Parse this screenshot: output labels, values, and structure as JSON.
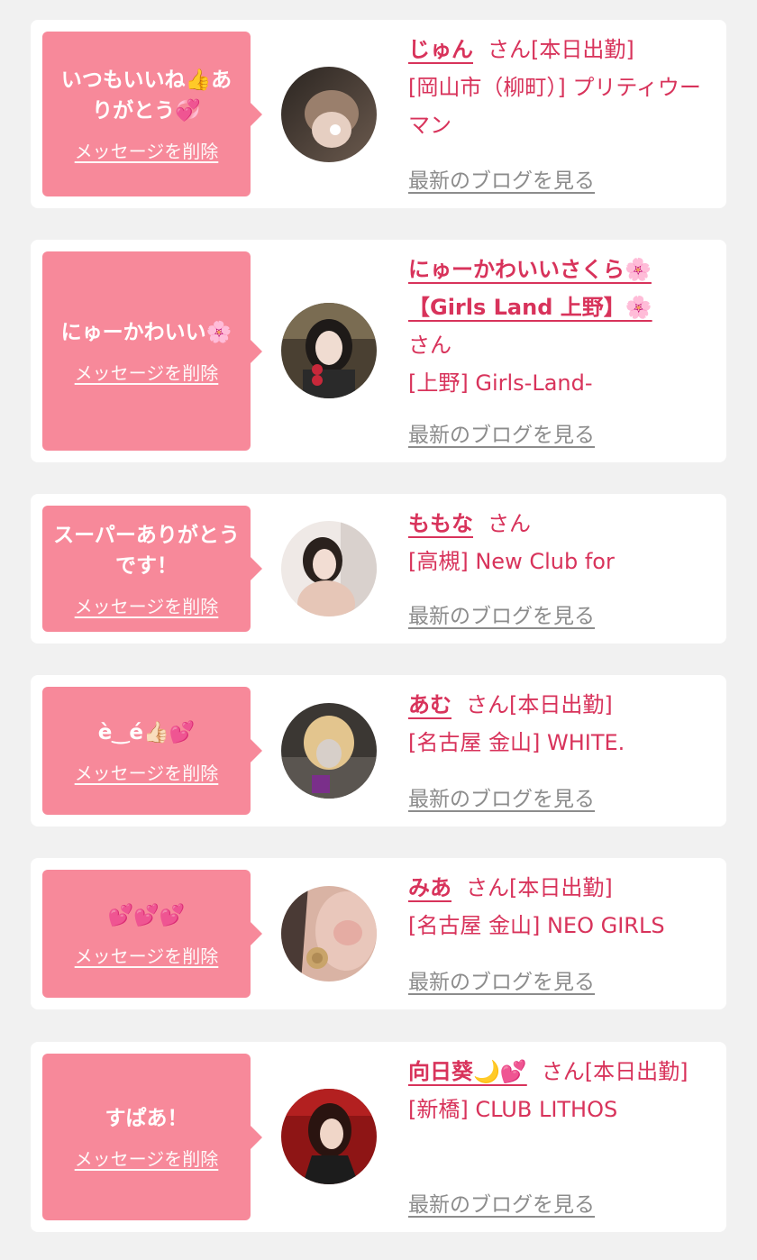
{
  "colors": {
    "background": "#f1f1f1",
    "card": "#ffffff",
    "bubble": "#f7899a",
    "accent": "#d8335b",
    "blog_link": "#8c8c8c"
  },
  "common": {
    "delete_label": "メッセージを削除",
    "blog_label": "最新のブログを見る"
  },
  "items": [
    {
      "message": "いつもいいね👍ありがとう💞",
      "name": "じゅん",
      "honorific": "さん",
      "status": "[本日出勤]",
      "store": "[岡山市（柳町）] プリティウーマン"
    },
    {
      "message": "にゅーかわいい🌸",
      "name": "にゅーかわいいさくら🌸【Girls Land 上野】🌸",
      "honorific": "さん",
      "status": "",
      "store": "[上野] Girls-Land-"
    },
    {
      "message": "スーパーありがとうです！",
      "name": "ももな",
      "honorific": "さん",
      "status": "",
      "store": "[高槻] New Club for"
    },
    {
      "message": "è‿é👍🏻💕",
      "name": "あむ",
      "honorific": "さん",
      "status": "[本日出勤]",
      "store": "[名古屋 金山] WHITE."
    },
    {
      "message": "💕💕💕",
      "name": "みあ",
      "honorific": "さん",
      "status": "[本日出勤]",
      "store": "[名古屋 金山] NEO GIRLS"
    },
    {
      "message": "すぱあ！",
      "name": "向日葵🌙💕",
      "honorific": "さん",
      "status": "[本日出勤]",
      "store": "[新橋] CLUB LITHOS"
    }
  ]
}
